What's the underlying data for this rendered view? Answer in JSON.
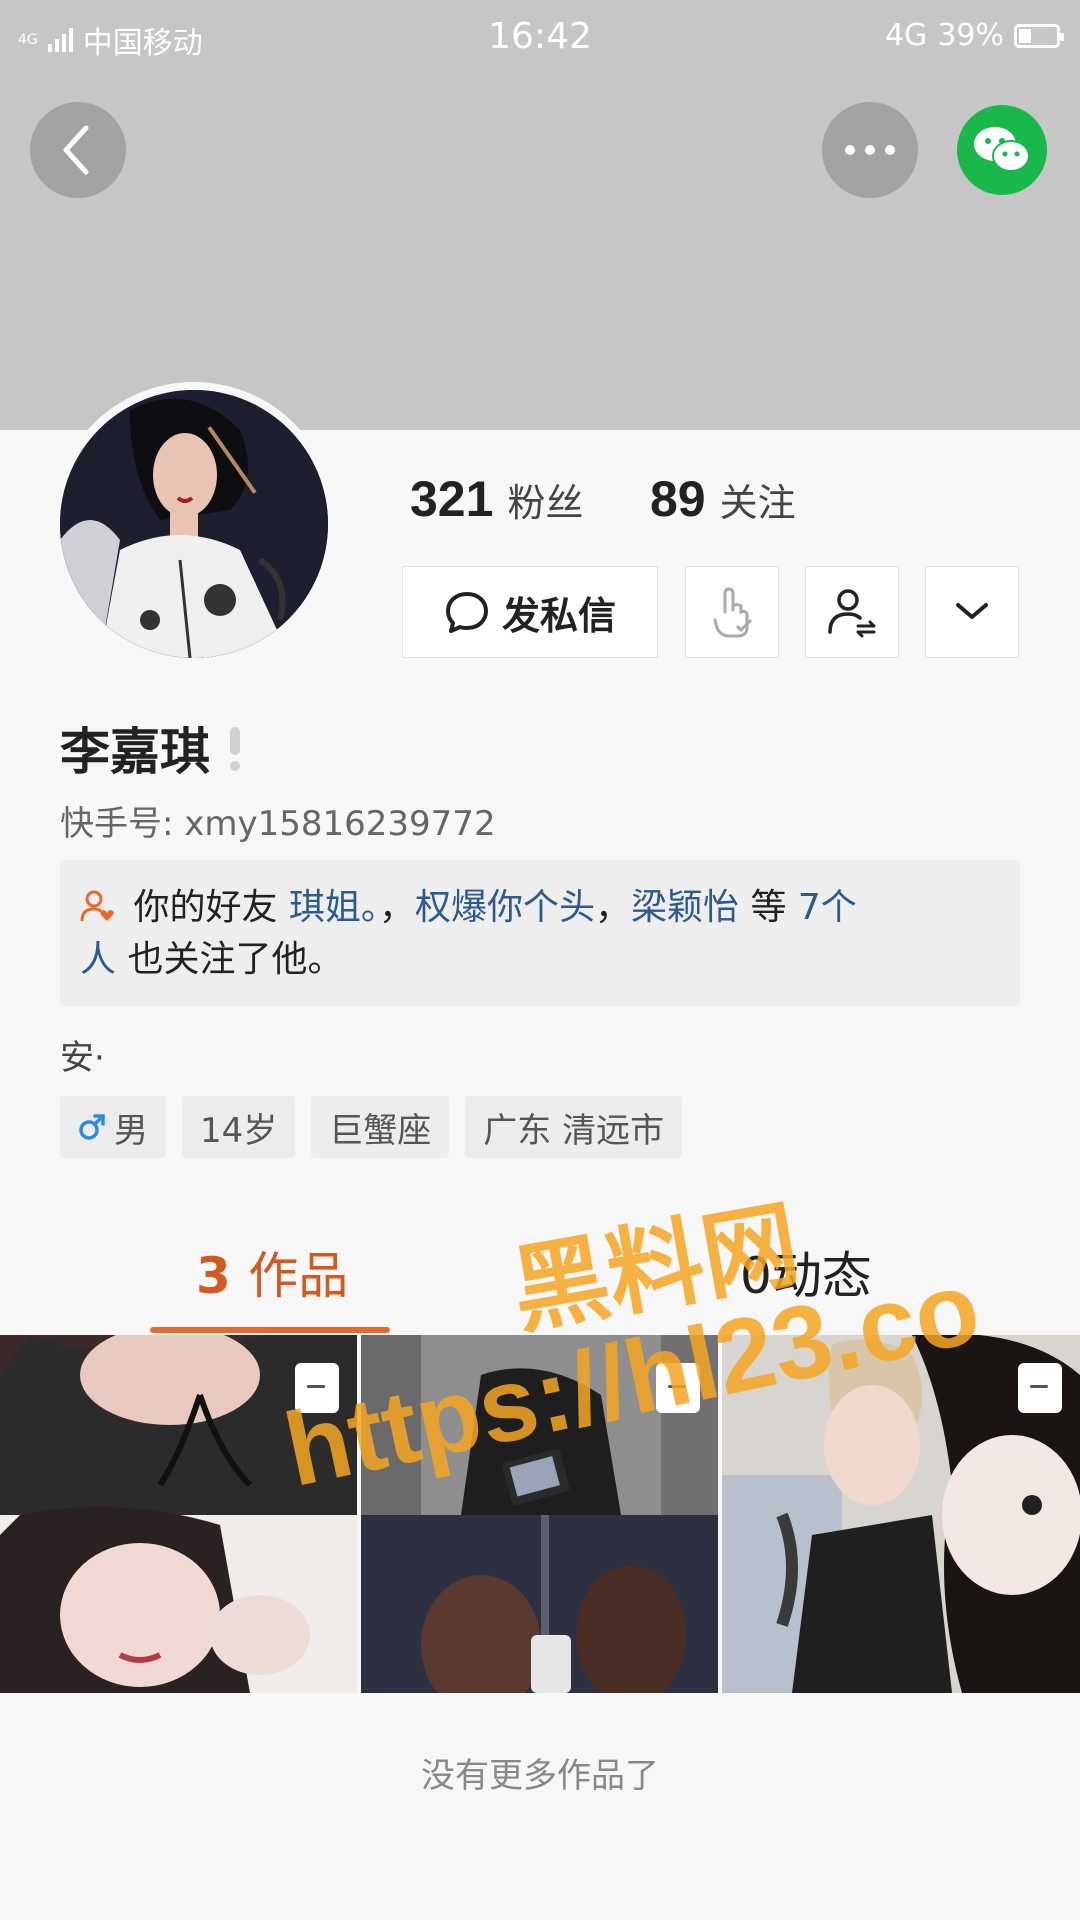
{
  "status_bar": {
    "network_small": "4G",
    "carrier": "中国移动",
    "time": "16:42",
    "network": "4G",
    "battery": "39%"
  },
  "header": {
    "back_icon": "chevron-left-icon",
    "more_icon": "more-dots-icon",
    "wechat_icon": "wechat-icon"
  },
  "profile": {
    "followers_count": "321",
    "followers_label": "粉丝",
    "following_count": "89",
    "following_label": "关注",
    "message_button": "发私信",
    "name": "李嘉琪",
    "kwai_id": "快手号: xmy15816239772",
    "mutual": {
      "prefix": "你的好友",
      "friend1": "琪姐。",
      "sep1": "，",
      "friend2": "权爆你个头",
      "sep2": "，",
      "friend3": "梁颖怡",
      "middle": " 等 ",
      "count_a": "7个",
      "count_b": "人",
      "suffix": " 也关注了他。"
    },
    "bio": "安·",
    "tags": {
      "gender": "男",
      "age": "14岁",
      "zodiac": "巨蟹座",
      "location": "广东 清远市"
    }
  },
  "tabs": {
    "works_count": "3",
    "works_label": "作品",
    "dynamic_count": "0",
    "dynamic_label": "动态"
  },
  "footer": {
    "no_more": "没有更多作品了"
  },
  "watermark": {
    "line1": "黑料网",
    "line2": "https://hl23.co"
  },
  "colors": {
    "accent": "#e86a2a",
    "link": "#2d5a8a",
    "wechat": "#1ab84a"
  }
}
